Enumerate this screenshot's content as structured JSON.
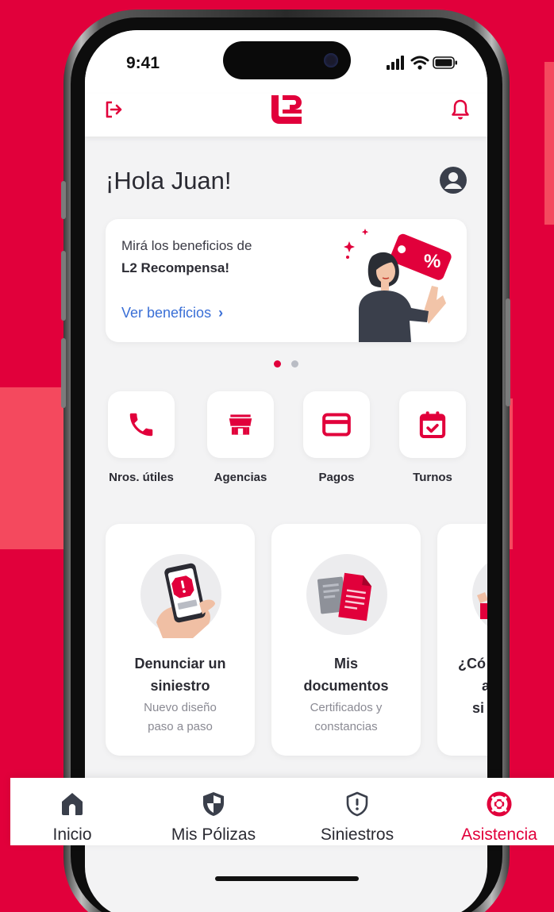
{
  "status_bar": {
    "time": "9:41"
  },
  "header": {
    "logo_text": "L2"
  },
  "greeting": "¡Hola Juan!",
  "promo": {
    "line1": "Mirá los beneficios de",
    "line2": "L2 Recompensa!",
    "link": "Ver beneficios",
    "tag_text": "%"
  },
  "quick_actions": [
    {
      "label": "Nros. útiles",
      "icon": "phone-icon"
    },
    {
      "label": "Agencias",
      "icon": "store-icon"
    },
    {
      "label": "Pagos",
      "icon": "credit-card-icon"
    },
    {
      "label": "Turnos",
      "icon": "calendar-check-icon"
    }
  ],
  "cards": [
    {
      "title_line1": "Denunciar un",
      "title_line2": "siniestro",
      "sub_line1": "Nuevo diseño",
      "sub_line2": "paso a paso"
    },
    {
      "title_line1": "Mis",
      "title_line2": "documentos",
      "sub_line1": "Certificados y",
      "sub_line2": "constancias"
    },
    {
      "title_line1": "¿Có",
      "title_line2": "a",
      "title_line3": "si"
    }
  ],
  "bottom_nav": [
    {
      "label": "Inicio",
      "icon": "home-icon",
      "active": false
    },
    {
      "label": "Mis Pólizas",
      "icon": "shield-icon",
      "active": false
    },
    {
      "label": "Siniestros",
      "icon": "shield-alert-icon",
      "active": false
    },
    {
      "label": "Asistencia",
      "icon": "lifebuoy-icon",
      "active": true
    }
  ],
  "colors": {
    "brand": "#e1003b",
    "text": "#2b2b33",
    "link": "#3a6fd6",
    "inactive_nav": "#3a3f4b"
  }
}
